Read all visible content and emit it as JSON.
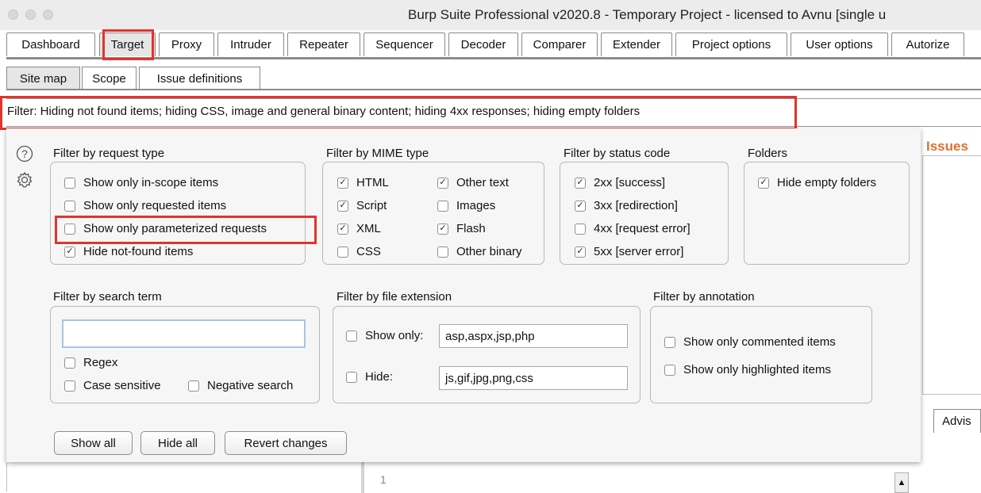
{
  "window": {
    "title": "Burp Suite Professional v2020.8 - Temporary Project - licensed to Avnu [single u"
  },
  "main_tabs": [
    "Dashboard",
    "Target",
    "Proxy",
    "Intruder",
    "Repeater",
    "Sequencer",
    "Decoder",
    "Comparer",
    "Extender",
    "Project options",
    "User options",
    "Autorize"
  ],
  "sub_tabs": [
    "Site map",
    "Scope",
    "Issue definitions"
  ],
  "filter_bar": {
    "text": "Filter: Hiding not found items;  hiding CSS, image and general binary content;  hiding 4xx responses;  hiding empty folders"
  },
  "filter_panel": {
    "request_type": {
      "title": "Filter by request type",
      "options": [
        {
          "label": "Show only in-scope items",
          "checked": false
        },
        {
          "label": "Show only requested items",
          "checked": false
        },
        {
          "label": "Show only parameterized requests",
          "checked": false
        },
        {
          "label": "Hide not-found items",
          "checked": true
        }
      ]
    },
    "mime_type": {
      "title": "Filter by MIME type",
      "options": [
        {
          "label": "HTML",
          "checked": true
        },
        {
          "label": "Other text",
          "checked": true
        },
        {
          "label": "Script",
          "checked": true
        },
        {
          "label": "Images",
          "checked": false
        },
        {
          "label": "XML",
          "checked": true
        },
        {
          "label": "Flash",
          "checked": true
        },
        {
          "label": "CSS",
          "checked": false
        },
        {
          "label": "Other binary",
          "checked": false
        }
      ]
    },
    "status_code": {
      "title": "Filter by status code",
      "options": [
        {
          "label": "2xx  [success]",
          "checked": true
        },
        {
          "label": "3xx  [redirection]",
          "checked": true
        },
        {
          "label": "4xx  [request error]",
          "checked": false
        },
        {
          "label": "5xx  [server error]",
          "checked": true
        }
      ]
    },
    "folders": {
      "title": "Folders",
      "options": [
        {
          "label": "Hide empty folders",
          "checked": true
        }
      ]
    },
    "search_term": {
      "title": "Filter by search term",
      "value": "",
      "options": [
        {
          "label": "Regex",
          "checked": false
        },
        {
          "label": "Case sensitive",
          "checked": false
        },
        {
          "label": "Negative search",
          "checked": false
        }
      ]
    },
    "file_extension": {
      "title": "Filter by file extension",
      "show_only": {
        "label": "Show only:",
        "checked": false,
        "value": "asp,aspx,jsp,php"
      },
      "hide": {
        "label": "Hide:",
        "checked": false,
        "value": "js,gif,jpg,png,css"
      }
    },
    "annotation": {
      "title": "Filter by annotation",
      "options": [
        {
          "label": "Show only commented items",
          "checked": false
        },
        {
          "label": "Show only highlighted items",
          "checked": false
        }
      ]
    },
    "buttons": {
      "show_all": "Show all",
      "hide_all": "Hide all",
      "revert": "Revert changes"
    }
  },
  "background": {
    "issues_label": "Issues",
    "advisory_tab": "Advis",
    "line_number": "1"
  },
  "icons": {
    "help": "help-icon",
    "settings": "gear-icon",
    "check": "checkmark-icon",
    "scroll_up": "arrow-up-icon"
  },
  "colors": {
    "highlight_red": "#e0342e",
    "issues_orange": "#e07030"
  }
}
